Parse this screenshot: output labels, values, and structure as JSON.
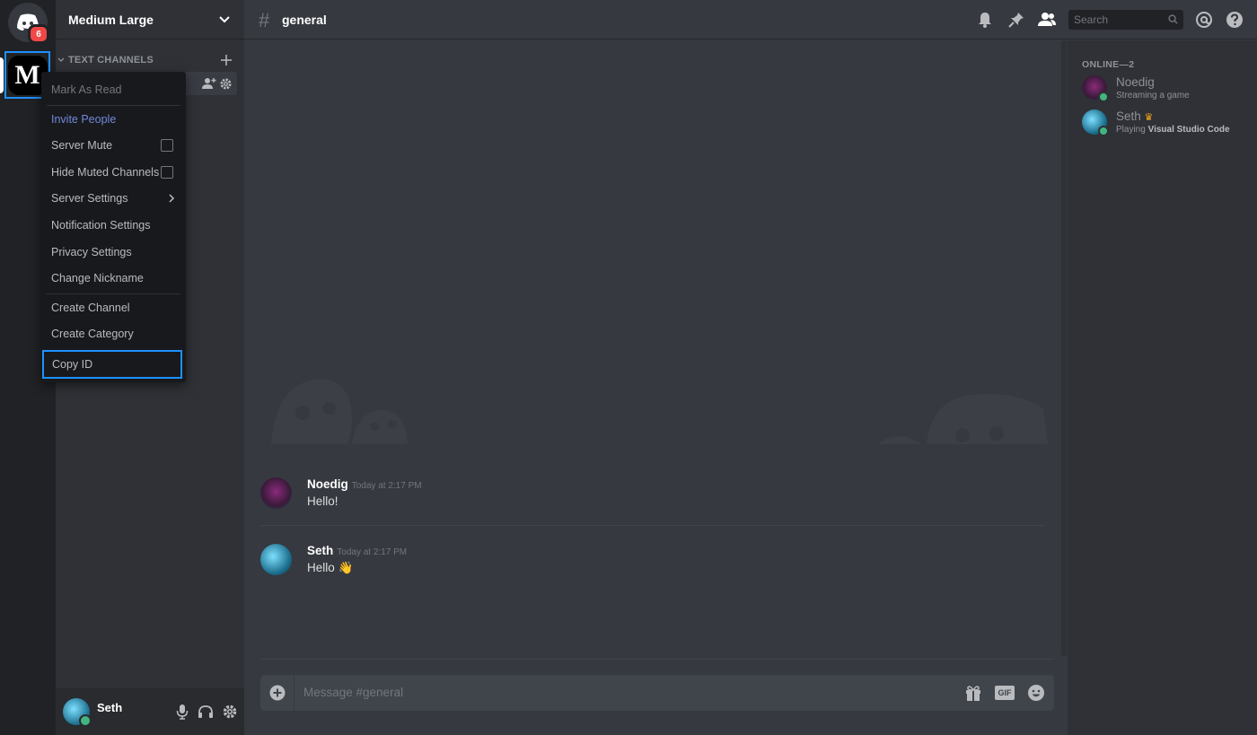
{
  "app": {
    "home_badge": "6",
    "server_initial": "M",
    "accent_blue": "#1e90ff",
    "online_green": "#43b581"
  },
  "guild": {
    "name": "Medium Large",
    "category": "TEXT CHANNELS"
  },
  "context_menu": {
    "mark_as_read": "Mark As Read",
    "invite_people": "Invite People",
    "server_mute": "Server Mute",
    "hide_muted": "Hide Muted Channels",
    "server_settings": "Server Settings",
    "notification_settings": "Notification Settings",
    "privacy_settings": "Privacy Settings",
    "change_nickname": "Change Nickname",
    "create_channel": "Create Channel",
    "create_category": "Create Category",
    "copy_id": "Copy ID"
  },
  "header": {
    "hash": "#",
    "channel": "general",
    "search_placeholder": "Search"
  },
  "messages": [
    {
      "author": "Noedig",
      "time": "Today at 2:17 PM",
      "text": "Hello!"
    },
    {
      "author": "Seth",
      "time": "Today at 2:17 PM",
      "text": "Hello 👋"
    }
  ],
  "composer": {
    "placeholder": "Message #general",
    "gif": "GIF"
  },
  "members": {
    "heading": "ONLINE—2",
    "list": [
      {
        "name": "Noedig",
        "activity_prefix": "Streaming a game",
        "activity_bold": ""
      },
      {
        "name": "Seth",
        "activity_prefix": "Playing ",
        "activity_bold": "Visual Studio Code",
        "crown": "♛"
      }
    ]
  },
  "user_panel": {
    "name": "Seth"
  }
}
